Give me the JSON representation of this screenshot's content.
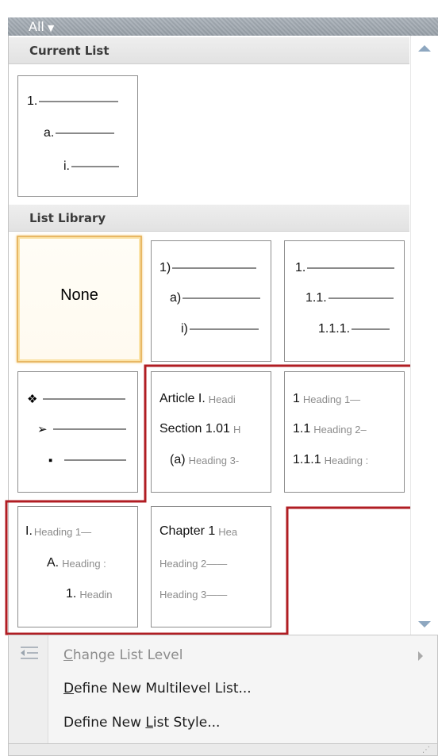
{
  "filter": {
    "label": "All",
    "caret": "▼"
  },
  "sections": {
    "current": "Current List",
    "library": "List Library"
  },
  "current_list": {
    "levels": [
      "1.",
      "a.",
      "i."
    ]
  },
  "library": {
    "none": "None",
    "tile_paren": [
      "1)",
      "a)",
      "i)"
    ],
    "tile_decimal": [
      "1.",
      "1.1.",
      "1.1.1."
    ],
    "tile_bullets": [
      "❖",
      "➢",
      "▪"
    ],
    "tile_article": [
      {
        "num": "Article I.",
        "text": "Headi"
      },
      {
        "num": "Section 1.01",
        "text": "H"
      },
      {
        "num": "(a)",
        "text": "Heading 3-"
      }
    ],
    "tile_heading_numbers": [
      {
        "num": "1",
        "text": "Heading 1—"
      },
      {
        "num": "1.1",
        "text": "Heading 2–"
      },
      {
        "num": "1.1.1",
        "text": "Heading :"
      }
    ],
    "tile_roman_heading": [
      {
        "num": "I.",
        "text": "Heading 1—"
      },
      {
        "num": "A.",
        "text": "Heading :"
      },
      {
        "num": "1.",
        "text": "Headin"
      }
    ],
    "tile_chapter": [
      {
        "num": "Chapter 1",
        "text": "Hea"
      },
      {
        "num": "",
        "text": "Heading 2——"
      },
      {
        "num": "",
        "text": "Heading 3——"
      }
    ]
  },
  "menu": {
    "change_level": {
      "accel": "C",
      "rest": "hange List Level"
    },
    "define_multilevel": {
      "accel": "D",
      "rest": "efine New Multilevel List..."
    },
    "define_style_pre": "Define New ",
    "define_style_accel": "L",
    "define_style_rest": "ist Style..."
  },
  "colors": {
    "highlight_border": "#b01d23",
    "hover_border": "#e8b764",
    "scroll_arrow": "#8ea7c0"
  }
}
